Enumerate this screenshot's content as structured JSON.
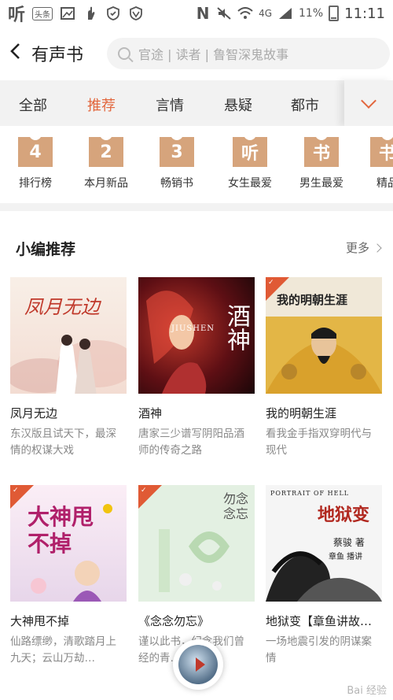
{
  "status_bar": {
    "left_app": "听",
    "left_badge": "头条",
    "network": "4G",
    "battery": "11%",
    "time": "11:11"
  },
  "header": {
    "title": "有声书",
    "search_placeholder": "官途 | 读者 | 鲁智深鬼故事"
  },
  "tabs": {
    "items": [
      "全部",
      "推荐",
      "言情",
      "悬疑",
      "都市"
    ],
    "active_index": 1
  },
  "categories": [
    {
      "badge": "4",
      "label": "排行榜"
    },
    {
      "badge": "2",
      "label": "本月新品"
    },
    {
      "badge": "3",
      "label": "畅销书"
    },
    {
      "badge": "听",
      "label": "女生最爱"
    },
    {
      "badge": "书",
      "label": "男生最爱"
    },
    {
      "badge": "书",
      "label": "精品"
    }
  ],
  "section": {
    "title": "小编推荐",
    "more": "更多"
  },
  "books": [
    {
      "title": "凤月无边",
      "desc": "东汉版且试天下，最深情的权谋大戏",
      "cover_text": "凤月无边",
      "cover_bg": "#f6ece4"
    },
    {
      "title": "酒神",
      "desc": "唐家三少谱写阴阳品酒师的传奇之路",
      "cover_text": "酒神",
      "cover_sub": "JIUSHEN",
      "cover_bg": "#3a0d12"
    },
    {
      "title": "我的明朝生涯",
      "desc": "看我金手指双穿明代与现代",
      "cover_text": "我的明朝生涯",
      "cover_bg": "#e8c25a"
    },
    {
      "title": "大神甩不掉",
      "desc": "仙路缥缈，清歌踏月上九天；云山万劫…",
      "cover_text": "大神甩不掉",
      "cover_bg": "#f2e6f0"
    },
    {
      "title": "《念念勿忘》",
      "desc": "谨以此书，纪念我们曾经的青…",
      "cover_text": "勿念 念忘",
      "cover_bg": "#dfeee0"
    },
    {
      "title": "地狱变【章鱼讲故…",
      "desc": "一场地震引发的阴谋案情",
      "cover_text": "地狱变",
      "cover_sub": "PORTRAIT OF HELL",
      "cover_author": "蔡骏 著",
      "cover_reader": "章鱼 播讲",
      "cover_bg": "#f4f4f4"
    }
  ],
  "watermark": "Bai 经验"
}
